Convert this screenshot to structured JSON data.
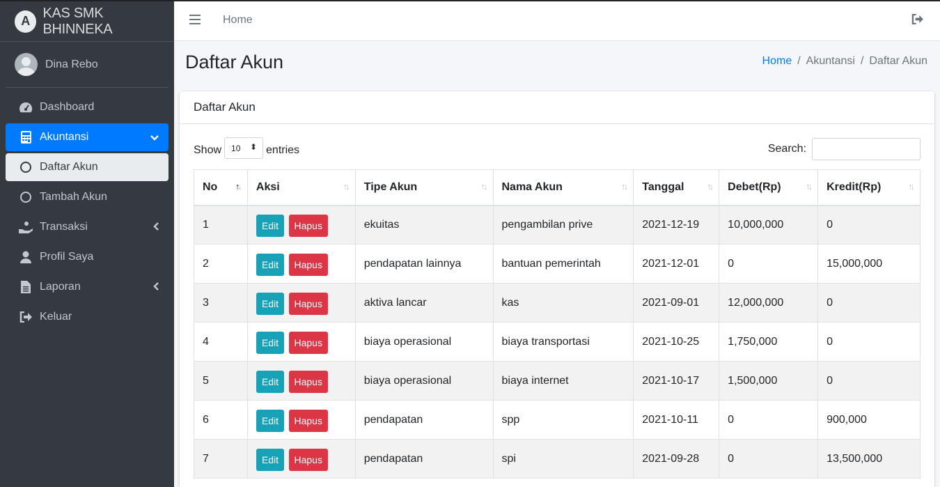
{
  "brand": {
    "logo_letter": "A",
    "name": "KAS SMK BHINNEKA"
  },
  "user": {
    "name": "Dina Rebo"
  },
  "sidebar": {
    "items": [
      {
        "label": "Dashboard",
        "icon": "tachometer-icon"
      },
      {
        "label": "Akuntansi",
        "icon": "calculator-icon",
        "state": "expanded"
      },
      {
        "label": "Daftar Akun",
        "icon": "circle-icon",
        "state": "selected"
      },
      {
        "label": "Tambah Akun",
        "icon": "circle-icon"
      },
      {
        "label": "Transaksi",
        "icon": "hand-coin-icon",
        "state": "collapsed"
      },
      {
        "label": "Profil Saya",
        "icon": "user-icon"
      },
      {
        "label": "Laporan",
        "icon": "file-icon",
        "state": "collapsed"
      },
      {
        "label": "Keluar",
        "icon": "sign-out-icon"
      }
    ]
  },
  "topbar": {
    "home_label": "Home"
  },
  "page": {
    "title": "Daftar Akun",
    "breadcrumb": [
      "Home",
      "Akuntansi",
      "Daftar Akun"
    ],
    "breadcrumb_separator": "/"
  },
  "card": {
    "title": "Daftar Akun",
    "show_label": "Show",
    "entries_value": "10",
    "entries_label": "entries",
    "search_label": "Search:",
    "search_value": ""
  },
  "table": {
    "columns": [
      "No",
      "Aksi",
      "Tipe Akun",
      "Nama Akun",
      "Tanggal",
      "Debet(Rp)",
      "Kredit(Rp)"
    ],
    "edit_label": "Edit",
    "delete_label": "Hapus",
    "rows": [
      {
        "no": "1",
        "tipe": "ekuitas",
        "nama": "pengambilan prive",
        "tanggal": "2021-12-19",
        "debet": "10,000,000",
        "kredit": "0"
      },
      {
        "no": "2",
        "tipe": "pendapatan lainnya",
        "nama": "bantuan pemerintah",
        "tanggal": "2021-12-01",
        "debet": "0",
        "kredit": "15,000,000"
      },
      {
        "no": "3",
        "tipe": "aktiva lancar",
        "nama": "kas",
        "tanggal": "2021-09-01",
        "debet": "12,000,000",
        "kredit": "0"
      },
      {
        "no": "4",
        "tipe": "biaya operasional",
        "nama": "biaya transportasi",
        "tanggal": "2021-10-25",
        "debet": "1,750,000",
        "kredit": "0"
      },
      {
        "no": "5",
        "tipe": "biaya operasional",
        "nama": "biaya internet",
        "tanggal": "2021-10-17",
        "debet": "1,500,000",
        "kredit": "0"
      },
      {
        "no": "6",
        "tipe": "pendapatan",
        "nama": "spp",
        "tanggal": "2021-10-11",
        "debet": "0",
        "kredit": "900,000"
      },
      {
        "no": "7",
        "tipe": "pendapatan",
        "nama": "spi",
        "tanggal": "2021-09-28",
        "debet": "0",
        "kredit": "13,500,000"
      }
    ]
  },
  "colors": {
    "sidebar_bg": "#343a40",
    "accent": "#007bff",
    "edit_btn": "#17a2b8",
    "delete_btn": "#dc3545"
  }
}
